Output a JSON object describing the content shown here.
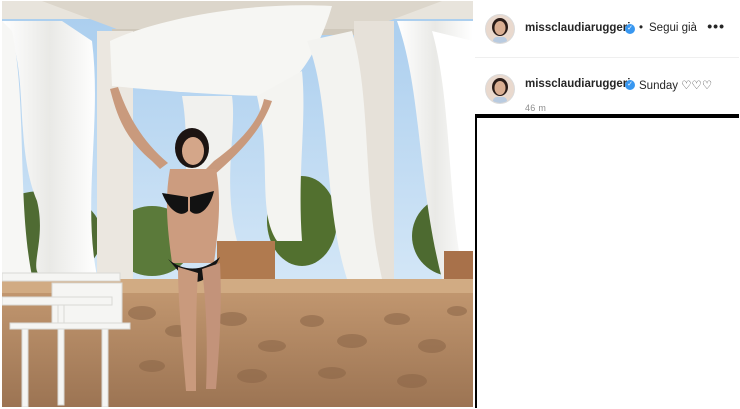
{
  "post": {
    "username": "missclaudiaruggeri",
    "verified": true,
    "follow_separator": "•",
    "follow_state": "Segui già",
    "more_glyph": "•••",
    "caption": {
      "username": "missclaudiaruggeri",
      "text": "Sunday ♡♡♡",
      "time_ago": "46 m"
    }
  },
  "colors": {
    "verified_blue": "#3897f0",
    "text": "#262626",
    "muted": "#8e8e8e",
    "sky": "#bfd9f2",
    "curtain": "#f4f4f2",
    "stone": "#b98d67"
  },
  "icons": {
    "verified": "verified-badge-icon",
    "more": "more-options-icon"
  }
}
